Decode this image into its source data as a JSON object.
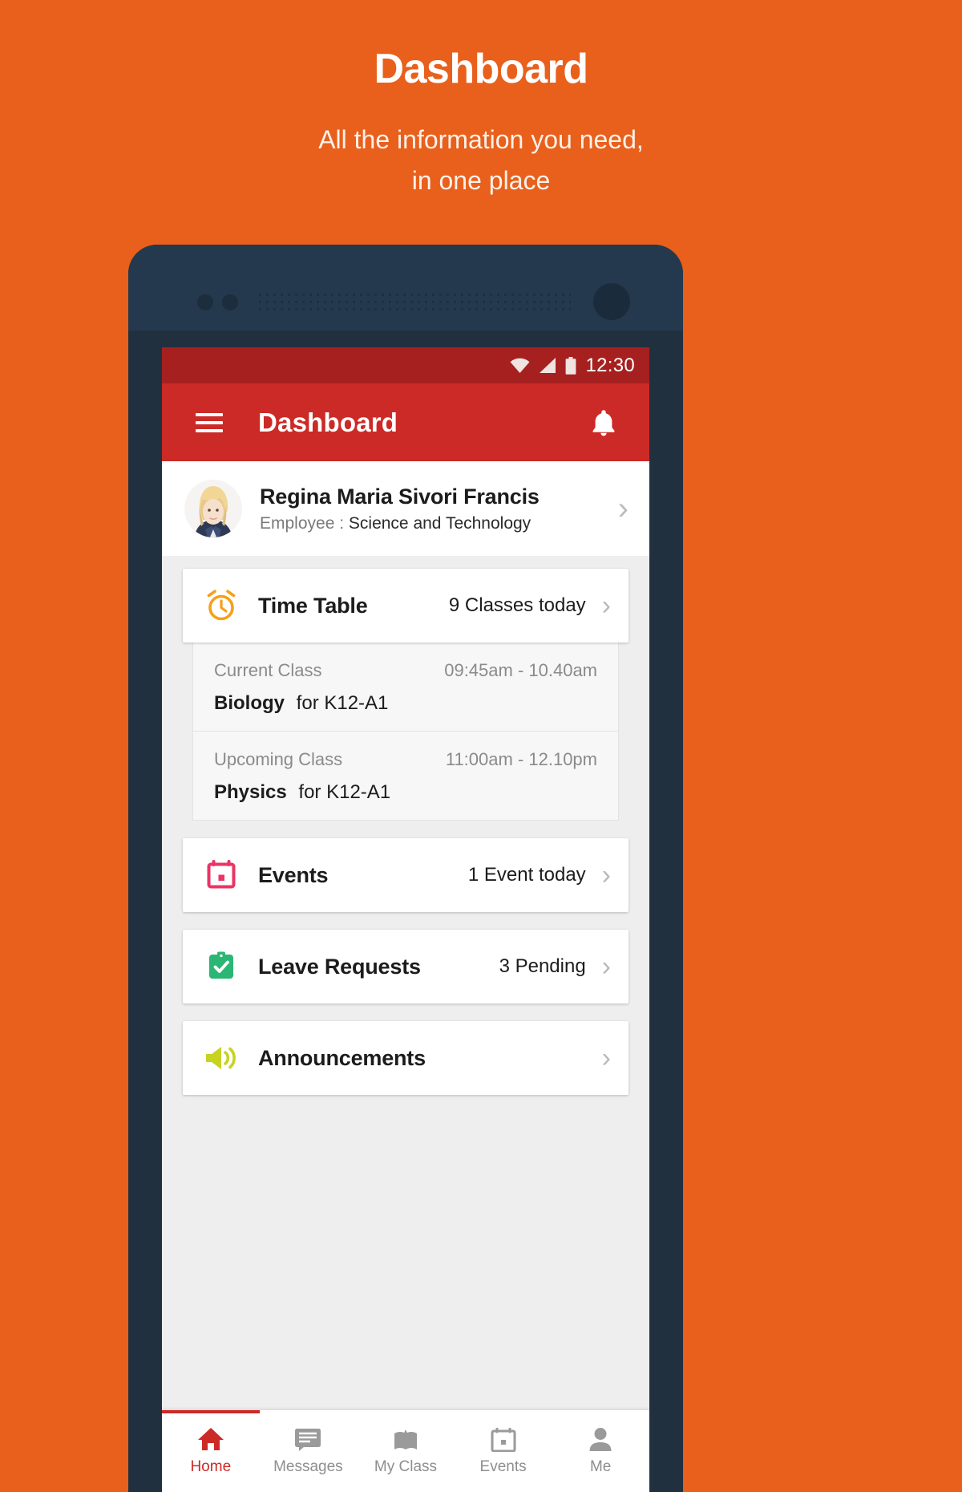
{
  "promo": {
    "title": "Dashboard",
    "subtitle_line1": "All the information you need,",
    "subtitle_line2": "in one place"
  },
  "statusbar": {
    "time": "12:30",
    "wifi_icon": "wifi-icon",
    "signal_icon": "signal-icon",
    "battery_icon": "battery-icon"
  },
  "appbar": {
    "menu_icon": "hamburger-menu-icon",
    "title": "Dashboard",
    "notification_icon": "bell-icon"
  },
  "profile": {
    "name": "Regina Maria Sivori Francis",
    "role_label": "Employee :",
    "department": "Science and Technology",
    "chevron": "›"
  },
  "cards": {
    "timetable": {
      "icon": "alarm-clock-icon",
      "icon_color": "#F6A01A",
      "label": "Time Table",
      "value": "9 Classes today",
      "arrow": "›"
    },
    "events": {
      "icon": "calendar-icon",
      "icon_color": "#EC3366",
      "label": "Events",
      "value": "1 Event today",
      "arrow": "›"
    },
    "leave": {
      "icon": "clipboard-check-icon",
      "icon_color": "#2BB673",
      "label": "Leave Requests",
      "value": "3 Pending",
      "arrow": "›"
    },
    "announcements": {
      "icon": "megaphone-icon",
      "icon_color": "#C7D321",
      "label": "Announcements",
      "value": "",
      "arrow": "›"
    }
  },
  "timetable_detail": [
    {
      "kind": "Current Class",
      "time": "09:45am - 10.40am",
      "subject": "Biology",
      "for": "for K12-A1"
    },
    {
      "kind": "Upcoming Class",
      "time": "11:00am - 12.10pm",
      "subject": "Physics",
      "for": "for K12-A1"
    }
  ],
  "bottomnav": {
    "items": [
      {
        "label": "Home",
        "icon": "home-icon",
        "active": true
      },
      {
        "label": "Messages",
        "icon": "message-icon",
        "active": false
      },
      {
        "label": "My Class",
        "icon": "class-icon",
        "active": false
      },
      {
        "label": "Events",
        "icon": "calendar-icon",
        "active": false
      },
      {
        "label": "Me",
        "icon": "person-icon",
        "active": false
      }
    ]
  },
  "colors": {
    "promo_background": "#E8601C",
    "appbar_red": "#CC2A26",
    "statusbar_red": "#A62020",
    "device_navy": "#20303F"
  }
}
